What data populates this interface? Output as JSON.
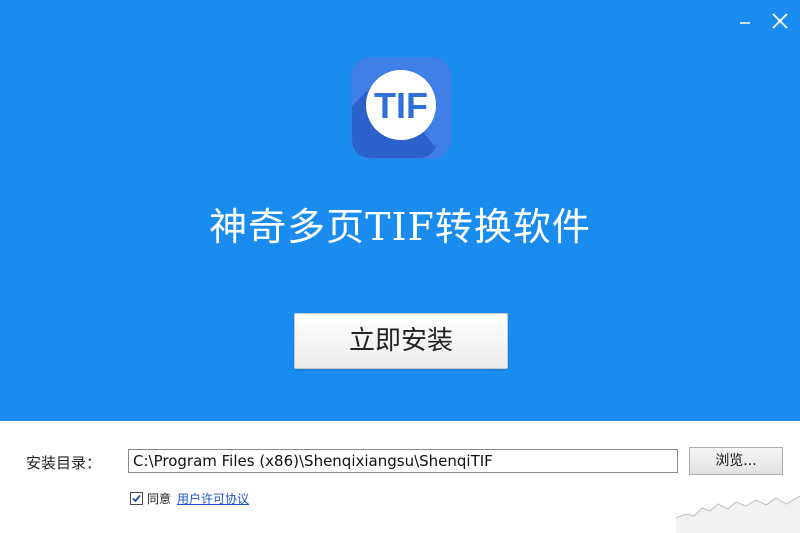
{
  "window": {
    "minimize_icon": "minimize-icon",
    "close_icon": "close-icon"
  },
  "hero": {
    "background_color": "#1a8cf0",
    "logo_text": "TIF",
    "app_title": "神奇多页TIF转换软件",
    "install_button_label": "立即安装"
  },
  "install_dir": {
    "label": "安装目录：",
    "path": "C:\\Program Files (x86)\\Shenqixiangsu\\ShenqiTIF",
    "browse_label": "浏览..."
  },
  "agreement": {
    "checked": true,
    "label": "同意",
    "link_text": "用户许可协议"
  }
}
